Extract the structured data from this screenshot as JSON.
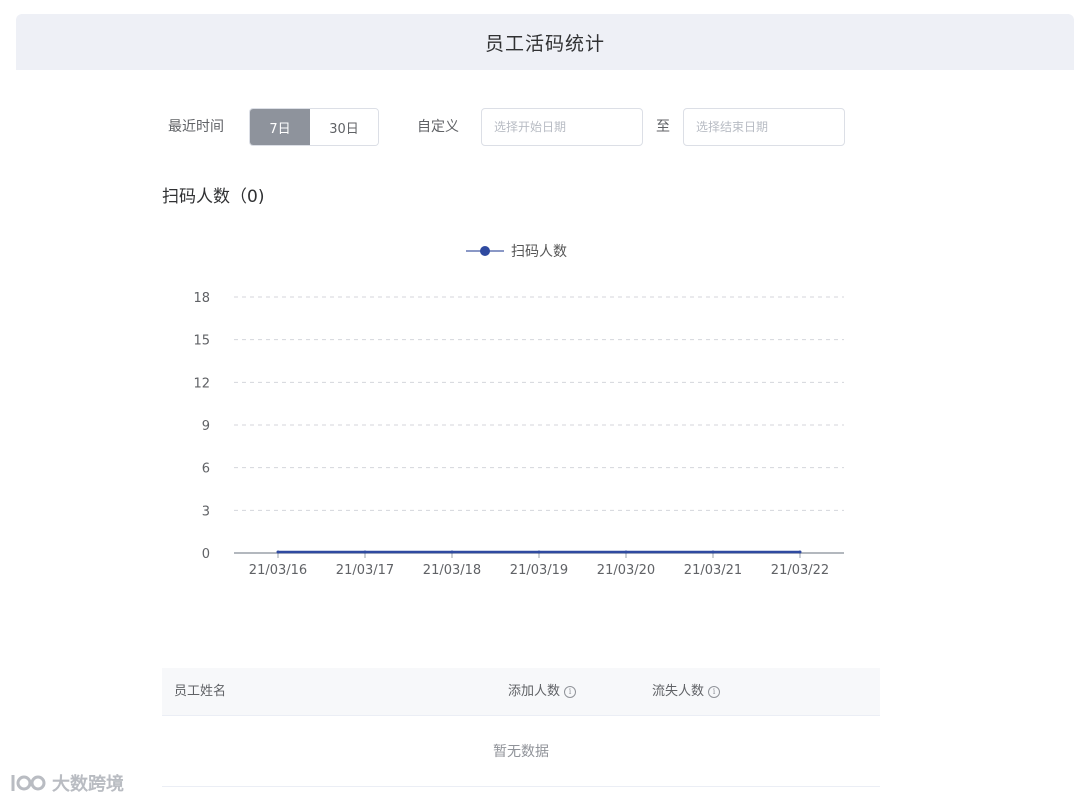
{
  "header": {
    "title": "员工活码统计"
  },
  "filters": {
    "recent_label": "最近时间",
    "range_options": [
      {
        "label": "7日",
        "active": true
      },
      {
        "label": "30日",
        "active": false
      }
    ],
    "custom_label": "自定义",
    "start_placeholder": "选择开始日期",
    "to_label": "至",
    "end_placeholder": "选择结束日期"
  },
  "section": {
    "title": "扫码人数（0)"
  },
  "chart_data": {
    "type": "line",
    "x": [
      "21/03/16",
      "21/03/17",
      "21/03/18",
      "21/03/19",
      "21/03/20",
      "21/03/21",
      "21/03/22"
    ],
    "series": [
      {
        "name": "扫码人数",
        "values": [
          0,
          0,
          0,
          0,
          0,
          0,
          0
        ],
        "color": "#2f4aa0"
      }
    ],
    "y_ticks": [
      "18",
      "15",
      "12",
      "9",
      "6",
      "3",
      "0"
    ],
    "ylim": [
      0,
      18
    ],
    "grid": true,
    "legend_position": "top-center"
  },
  "table": {
    "columns": [
      {
        "label": "员工姓名",
        "info": false
      },
      {
        "label": "添加人数",
        "info": true
      },
      {
        "label": "流失人数",
        "info": true
      }
    ],
    "empty_text": "暂无数据"
  },
  "watermark": {
    "text": "大数跨境"
  }
}
